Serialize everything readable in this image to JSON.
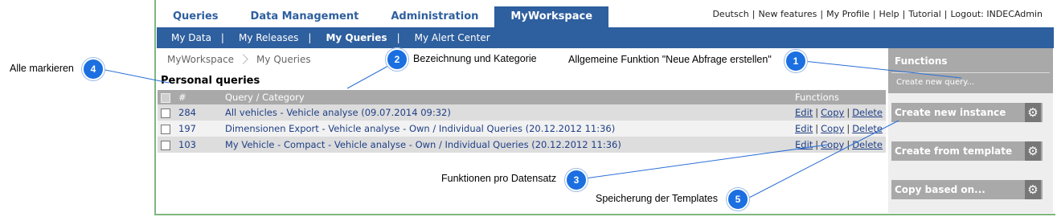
{
  "topnav": {
    "tabs": [
      {
        "label": "Queries",
        "active": false
      },
      {
        "label": "Data Management",
        "active": false
      },
      {
        "label": "Administration",
        "active": false
      },
      {
        "label": "MyWorkspace",
        "active": true
      }
    ]
  },
  "toplinks": [
    "Deutsch",
    "New features",
    "My Profile",
    "Help",
    "Tutorial",
    "Logout: INDECAdmin"
  ],
  "subnav": [
    "My Data",
    "My Releases",
    "My Queries",
    "My Alert Center"
  ],
  "breadcrumb": [
    "MyWorkspace",
    "My Queries"
  ],
  "section_title": "Personal queries",
  "table": {
    "headers": {
      "num": "#",
      "query": "Query / Category",
      "functions": "Functions"
    },
    "rows": [
      {
        "id": "284",
        "query": "All vehicles - Vehicle analyse (09.07.2014 09:32)"
      },
      {
        "id": "197",
        "query": "Dimensionen Export - Vehicle analyse - Own / Individual Queries (20.12.2012 11:36)"
      },
      {
        "id": "103",
        "query": "My Vehicle - Compact - Vehicle analyse - Own / Individual Queries (20.12.2012 11:36)"
      }
    ],
    "functions": {
      "edit": "Edit",
      "copy": "Copy",
      "delete": "Delete"
    }
  },
  "functions_panel": {
    "title": "Functions",
    "create_link": "Create new query...",
    "buttons": [
      "Create new instance",
      "Create from template",
      "Copy based on..."
    ]
  },
  "annotations": [
    {
      "num": "1",
      "text": "Allgemeine Funktion \"Neue Abfrage erstellen\""
    },
    {
      "num": "2",
      "text": "Bezeichnung und Kategorie"
    },
    {
      "num": "3",
      "text": "Funktionen pro Datensatz"
    },
    {
      "num": "4",
      "text": "Alle markieren"
    },
    {
      "num": "5",
      "text": "Speicherung der Templates"
    }
  ],
  "colors": {
    "nav_blue": "#2e5f9e",
    "header_gray": "#a9a9a9",
    "badge_blue": "#1b6fe0",
    "frame_green": "#7fb77f"
  }
}
